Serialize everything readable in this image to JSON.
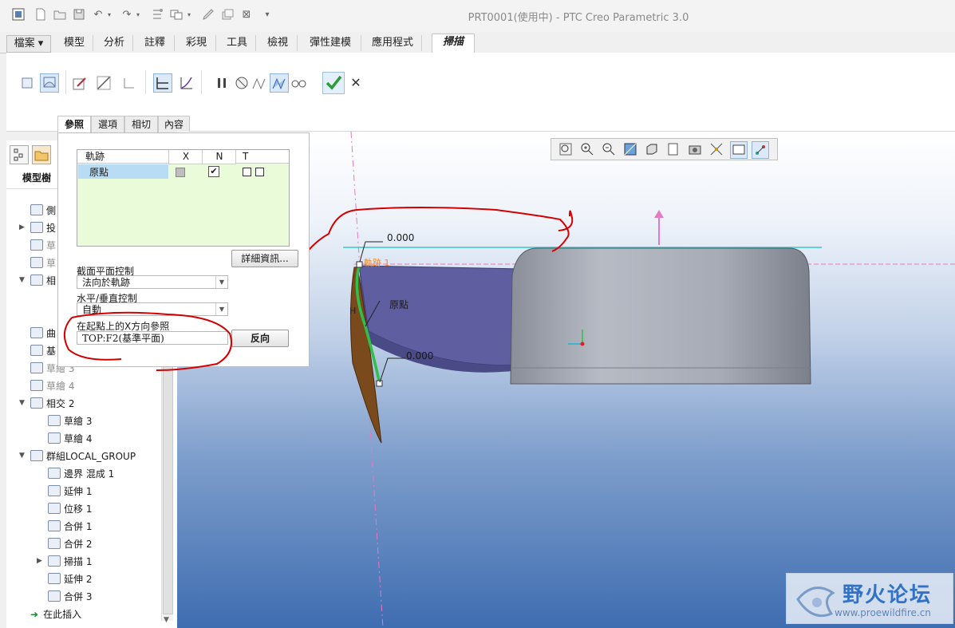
{
  "window": {
    "title": "PRT0001(使用中) - PTC Creo Parametric 3.0"
  },
  "ribbon_tabs": [
    {
      "label": "檔案",
      "has_dropdown": true
    },
    {
      "label": "模型"
    },
    {
      "label": "分析"
    },
    {
      "label": "註釋"
    },
    {
      "label": "彩現"
    },
    {
      "label": "工具"
    },
    {
      "label": "檢視"
    },
    {
      "label": "彈性建模"
    },
    {
      "label": "應用程式"
    },
    {
      "label": "掃描",
      "active": true
    }
  ],
  "dashboard_tabs": [
    "參照",
    "選項",
    "相切",
    "內容"
  ],
  "model_tree": {
    "header": "模型樹",
    "items": [
      {
        "label": "側"
      },
      {
        "label": "投"
      },
      {
        "label": "草",
        "dim": true
      },
      {
        "label": "草",
        "dim": true
      },
      {
        "label": "相"
      },
      {
        "label": "曲"
      },
      {
        "label": "基"
      },
      {
        "label": "草繪 3",
        "dim": true
      },
      {
        "label": "草繪 4",
        "dim": true
      },
      {
        "label": "相交 2"
      },
      {
        "label": "草繪 3"
      },
      {
        "label": "草繪 4"
      },
      {
        "label": "群組LOCAL_GROUP"
      },
      {
        "label": "邊界 混成 1"
      },
      {
        "label": "延伸 1"
      },
      {
        "label": "位移 1"
      },
      {
        "label": "合併 1"
      },
      {
        "label": "合併 2"
      },
      {
        "label": "掃描 1"
      },
      {
        "label": "延伸 2"
      },
      {
        "label": "合併 3"
      },
      {
        "label": "在此插入"
      }
    ]
  },
  "references_panel": {
    "trajectory_table": {
      "columns": [
        "軌跡",
        "X",
        "N",
        "T"
      ],
      "rows": [
        {
          "name": "原點",
          "x": false,
          "n": true,
          "t": false
        }
      ]
    },
    "details_button": "詳細資訊...",
    "section_plane_label": "截面平面控制",
    "section_plane_value": "法向於軌跡",
    "hv_control_label": "水平/垂直控制",
    "hv_control_value": "自動",
    "x_ref_label": "在起點上的X方向參照",
    "x_ref_value": "TOP:F2(基準平面)",
    "flip_button": "反向"
  },
  "graphics": {
    "dimension_top": "0.000",
    "dimension_bottom": "0.000",
    "origin_label": "原點",
    "annotation_label": "軌跡 1"
  },
  "watermark": {
    "text": "野火论坛",
    "url": "www.proewildfire.cn"
  },
  "colors": {
    "accent": "#2f72c8",
    "confirm": "#2f9a3b",
    "annotation": "#d40000"
  },
  "icons": [
    "new-icon",
    "open-icon",
    "save-icon",
    "undo-icon",
    "redo-icon",
    "regenerate-icon",
    "windows-icon",
    "close-window-icon",
    "pause-icon",
    "no-preview-icon",
    "verify-icon",
    "feature-preview-icon",
    "glasses-icon",
    "ok-check-icon",
    "cancel-x-icon"
  ]
}
